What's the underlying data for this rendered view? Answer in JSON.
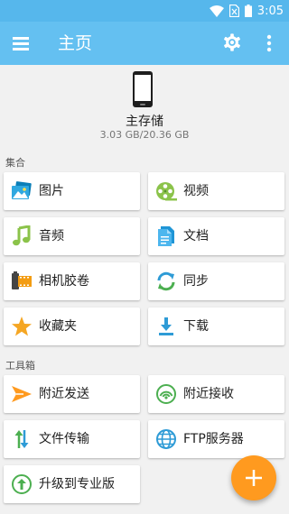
{
  "status_bar": {
    "time": "3:05"
  },
  "app_bar": {
    "title": "主页"
  },
  "storage": {
    "name": "主存储",
    "usage": "3.03 GB/20.36 GB"
  },
  "collections": {
    "title": "集合",
    "items": [
      {
        "label": "图片",
        "icon": "pictures-icon"
      },
      {
        "label": "视频",
        "icon": "film-reel-icon"
      },
      {
        "label": "音频",
        "icon": "music-note-icon"
      },
      {
        "label": "文档",
        "icon": "document-icon"
      },
      {
        "label": "相机胶卷",
        "icon": "camera-roll-icon"
      },
      {
        "label": "同步",
        "icon": "sync-icon"
      },
      {
        "label": "收藏夹",
        "icon": "star-icon"
      },
      {
        "label": "下载",
        "icon": "download-icon"
      }
    ]
  },
  "toolbox": {
    "title": "工具箱",
    "items": [
      {
        "label": "附近发送",
        "icon": "send-icon"
      },
      {
        "label": "附近接收",
        "icon": "receive-signal-icon"
      },
      {
        "label": "文件传输",
        "icon": "transfer-icon"
      },
      {
        "label": "FTP服务器",
        "icon": "globe-icon"
      },
      {
        "label": "升级到专业版",
        "icon": "upgrade-icon"
      }
    ]
  },
  "colors": {
    "app_bar": "#64c0f1",
    "status_bar": "#56b7ec",
    "fab": "#ff9a1f",
    "background": "#f1f1f1"
  }
}
